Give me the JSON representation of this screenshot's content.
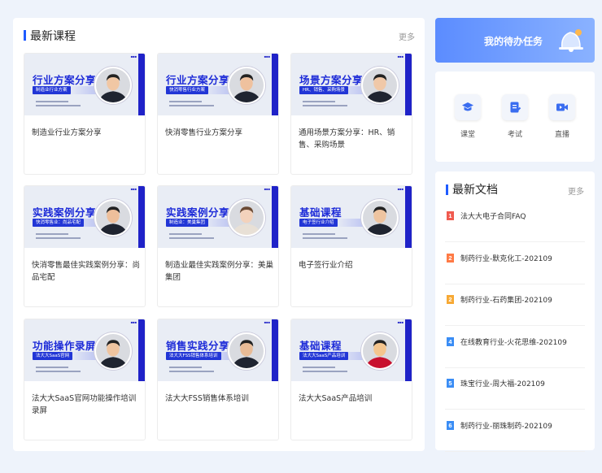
{
  "courses": {
    "title": "最新课程",
    "more": "更多",
    "items": [
      {
        "thumb_title": "行业方案分享",
        "thumb_tag": "制造业行业方案",
        "caption": "制造业行业方案分享"
      },
      {
        "thumb_title": "行业方案分享",
        "thumb_tag": "快消零售行业方案",
        "caption": "快消零售行业方案分享"
      },
      {
        "thumb_title": "场景方案分享",
        "thumb_tag": "HR、销售、采购场景",
        "caption": "通用场景方案分享：HR、销售、采购场景"
      },
      {
        "thumb_title": "实践案例分享",
        "thumb_tag": "快消零售业：尚品宅配",
        "caption": "快消零售最佳实践案例分享：尚品宅配"
      },
      {
        "thumb_title": "实践案例分享",
        "thumb_tag": "制造业：美巢集团",
        "caption": "制造业最佳实践案例分享：美巢集团"
      },
      {
        "thumb_title": "基础课程",
        "thumb_tag": "电子签行业介绍",
        "caption": "电子签行业介绍"
      },
      {
        "thumb_title": "功能操作录屏",
        "thumb_tag": "法大大SaaS官网",
        "caption": "法大大SaaS官网功能操作培训录屏"
      },
      {
        "thumb_title": "销售实践分享",
        "thumb_tag": "法大大FSS销售体系培训",
        "caption": "法大大FSS销售体系培训"
      },
      {
        "thumb_title": "基础课程",
        "thumb_tag": "法大大SaaS产品培训",
        "caption": "法大大SaaS产品培训"
      }
    ]
  },
  "todo": {
    "label": "我的待办任务"
  },
  "quick": {
    "items": [
      {
        "label": "课堂",
        "icon": "classroom-icon"
      },
      {
        "label": "考试",
        "icon": "exam-icon"
      },
      {
        "label": "直播",
        "icon": "live-icon"
      }
    ]
  },
  "docs": {
    "title": "最新文档",
    "more": "更多",
    "items": [
      {
        "rank": "1",
        "name": "法大大电子合同FAQ",
        "color": "#f05a4f"
      },
      {
        "rank": "2",
        "name": "制药行业-默克化工-202109",
        "color": "#ff7a45"
      },
      {
        "rank": "2",
        "name": "制药行业-石药集团-202109",
        "color": "#f7a934"
      },
      {
        "rank": "4",
        "name": "在线教育行业-火花思维-202109",
        "color": "#3a8df5"
      },
      {
        "rank": "5",
        "name": "珠宝行业-周大福-202109",
        "color": "#3a8df5"
      },
      {
        "rank": "6",
        "name": "制药行业-丽珠制药-202109",
        "color": "#3a8df5"
      }
    ]
  },
  "colors": {
    "accent": "#1f5bff",
    "thumb_blue": "#1d2bd8",
    "bg": "#eef3fb"
  }
}
